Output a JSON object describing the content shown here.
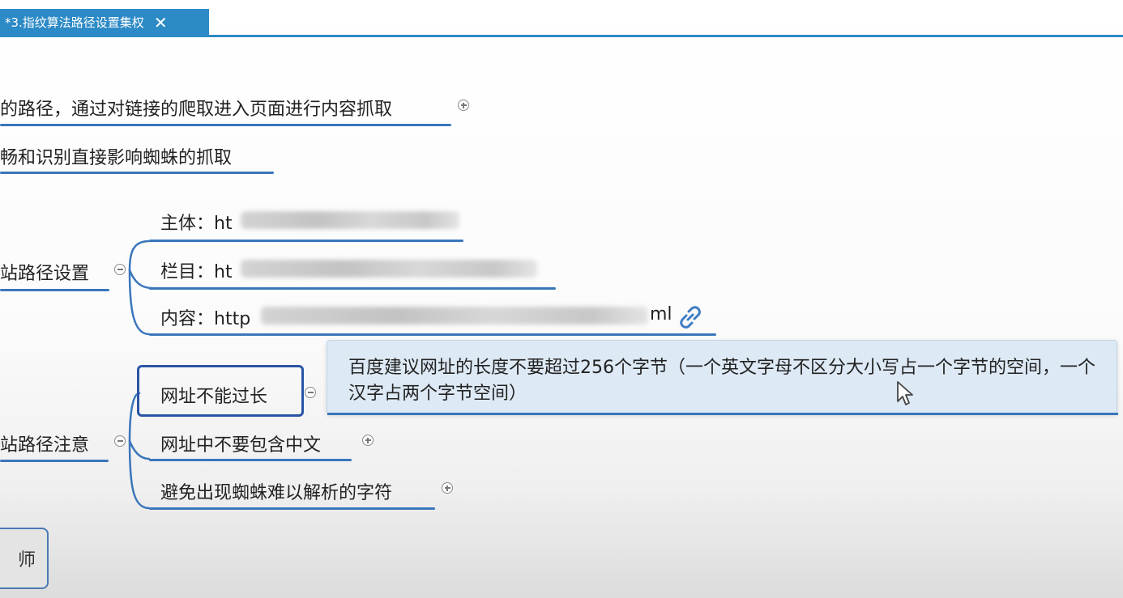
{
  "tab": {
    "title": "*3.指纹算法路径设置集权",
    "close": "✕"
  },
  "nodes": {
    "line1": "的路径，通过对链接的爬取进入页面进行内容抓取",
    "line2": "畅和识别直接影响蜘蛛的抓取",
    "path_settings": "站路径设置",
    "subject": "主体：ht",
    "column": "栏目：ht",
    "content": "内容：http",
    "content_suffix": "ml",
    "path_notes": "站路径注意",
    "url_not_long": "网址不能过长",
    "no_chinese": "网址中不要包含中文",
    "avoid_chars": "避免出现蜘蛛难以解析的字符",
    "teacher": "师"
  },
  "callout": {
    "text": "百度建议网址的长度不要超过256个字节（一个英文字母不区分大小写占一个字节的空间，一个汉字占两个字节空间）"
  },
  "icons": {
    "close": "close-icon",
    "link": "link-icon",
    "cursor": "mouse-cursor-icon",
    "expand": "expand-icon",
    "collapse": "collapse-icon"
  },
  "colors": {
    "accent": "#2c8ac6",
    "underline": "#3a76bb",
    "callout_bg": "#dde9f4",
    "selected_border": "#2a55a6"
  }
}
